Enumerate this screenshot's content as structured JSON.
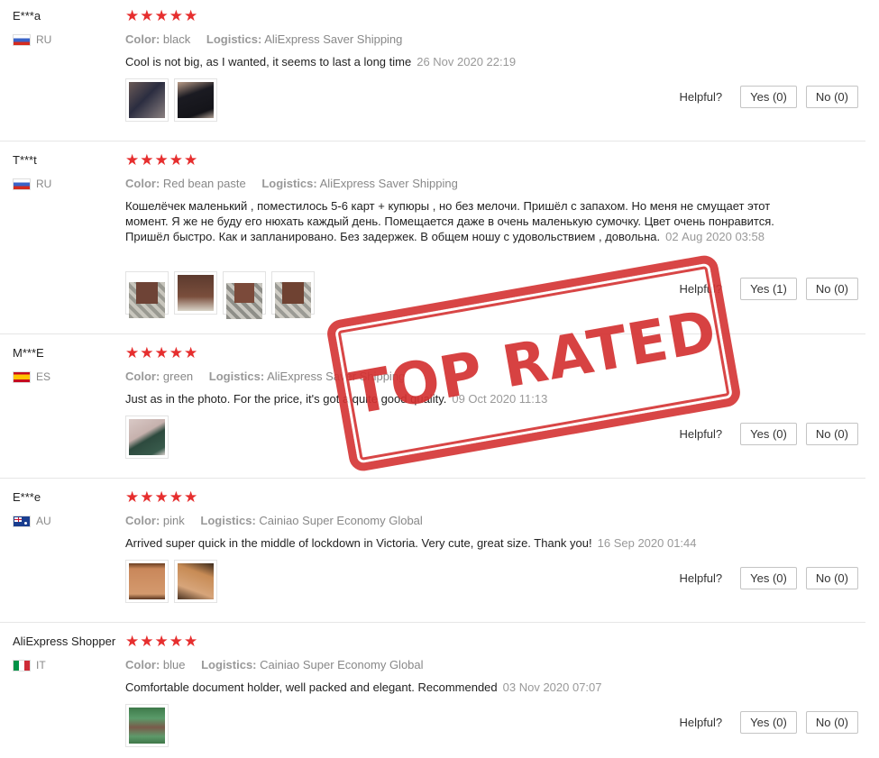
{
  "helpful_label": "Helpful?",
  "labels": {
    "color": "Color:",
    "logistics": "Logistics:"
  },
  "stamp": {
    "text": "TOP RATED",
    "color": "#d43232"
  },
  "star_color": "#e62e2e",
  "reviews": [
    {
      "user": "E***a",
      "country": "RU",
      "flag": "flag-ru",
      "stars": "★★★★★",
      "color": "black",
      "logistics": "AliExpress Saver Shipping",
      "comment": "Cool is not big, as I wanted, it seems to last a long time",
      "date": "26 Nov 2020 22:19",
      "yes": "Yes (0)",
      "no": "No (0)",
      "images": [
        "photo-thumbnail",
        "photo-thumbnail"
      ]
    },
    {
      "user": "T***t",
      "country": "RU",
      "flag": "flag-ru",
      "stars": "★★★★★",
      "color": "Red bean paste",
      "logistics": "AliExpress Saver Shipping",
      "comment": "Кошелёчек маленький , поместилось 5-6 карт + купюры , но без мелочи. Пришёл с запахом. Но меня не смущает этот момент. Я же не буду его нюхать каждый день. Помещается даже в очень маленькую сумочку. Цвет очень понравится. Пришёл быстро. Как и запланировано. Без задержек. В общем ношу с удовольствием , довольна.",
      "date": "02 Aug 2020 03:58",
      "yes": "Yes (1)",
      "no": "No (0)",
      "images": [
        "photo-thumbnail",
        "photo-thumbnail",
        "photo-thumbnail",
        "photo-thumbnail"
      ]
    },
    {
      "user": "M***E",
      "country": "ES",
      "flag": "flag-es",
      "stars": "★★★★★",
      "color": "green",
      "logistics": "AliExpress Saver Shipping",
      "comment": "Just as in the photo. For the price, it's got a quite good quality.",
      "date": "09 Oct 2020 11:13",
      "yes": "Yes (0)",
      "no": "No (0)",
      "images": [
        "photo-thumbnail"
      ]
    },
    {
      "user": "E***e",
      "country": "AU",
      "flag": "flag-au",
      "stars": "★★★★★",
      "color": "pink",
      "logistics": "Cainiao Super Economy Global",
      "comment": "Arrived super quick in the middle of lockdown in Victoria. Very cute, great size. Thank you!",
      "date": "16 Sep 2020 01:44",
      "yes": "Yes (0)",
      "no": "No (0)",
      "images": [
        "photo-thumbnail",
        "photo-thumbnail"
      ]
    },
    {
      "user": "AliExpress Shopper",
      "country": "IT",
      "flag": "flag-it",
      "stars": "★★★★★",
      "color": "blue",
      "logistics": "Cainiao Super Economy Global",
      "comment": "Comfortable document holder, well packed and elegant. Recommended",
      "date": "03 Nov 2020 07:07",
      "yes": "Yes (0)",
      "no": "No (0)",
      "images": [
        "photo-thumbnail"
      ]
    }
  ]
}
